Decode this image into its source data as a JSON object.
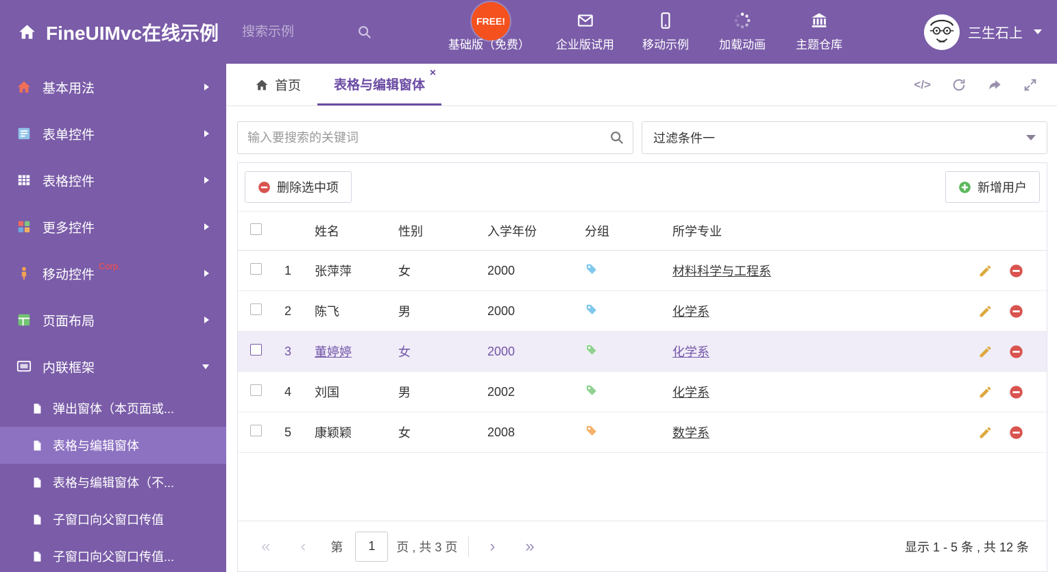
{
  "colors": {
    "accent": "#7a5ca8",
    "sidebar_active": "#8d72c2",
    "selected_row_bg": "#f0ecf8",
    "selected_row_text": "#7356a8",
    "danger": "#d9534f",
    "success": "#5cb85c",
    "pencil": "#dda83c",
    "free_badge_bg": "#f4511e"
  },
  "header": {
    "title": "FineUIMvc在线示例",
    "search_placeholder": "搜索示例",
    "free_badge": "FREE!",
    "nav": [
      {
        "label": "基础版（免费）",
        "icon": "download-icon"
      },
      {
        "label": "企业版试用",
        "icon": "envelope-icon"
      },
      {
        "label": "移动示例",
        "icon": "mobile-icon"
      },
      {
        "label": "加载动画",
        "icon": "spinner-icon"
      },
      {
        "label": "主题仓库",
        "icon": "bank-icon"
      }
    ],
    "user_name": "三生石上"
  },
  "sidebar": {
    "items": [
      {
        "label": "基本用法"
      },
      {
        "label": "表单控件"
      },
      {
        "label": "表格控件"
      },
      {
        "label": "更多控件"
      },
      {
        "label": "移动控件",
        "badge": "Corp."
      },
      {
        "label": "页面布局"
      },
      {
        "label": "内联框架"
      }
    ],
    "subitems": [
      {
        "label": "弹出窗体（本页面或..."
      },
      {
        "label": "表格与编辑窗体"
      },
      {
        "label": "表格与编辑窗体（不..."
      },
      {
        "label": "子窗口向父窗口传值"
      },
      {
        "label": "子窗口向父窗口传值..."
      }
    ]
  },
  "tabs": {
    "home_label": "首页",
    "active_label": "表格与编辑窗体",
    "close_symbol": "×",
    "code_tool": "</>"
  },
  "filter": {
    "search_placeholder": "输入要搜索的关键词",
    "selected_filter": "过滤条件一"
  },
  "toolbar": {
    "delete_label": "删除选中项",
    "add_label": "新增用户"
  },
  "table": {
    "headers": {
      "name": "姓名",
      "gender": "性别",
      "year": "入学年份",
      "group": "分组",
      "major": "所学专业"
    },
    "rows": [
      {
        "num": "1",
        "name": "张萍萍",
        "gender": "女",
        "year": "2000",
        "tag_color": "#7ec8ed",
        "major": "材料科学与工程系"
      },
      {
        "num": "2",
        "name": "陈飞",
        "gender": "男",
        "year": "2000",
        "tag_color": "#7ec8ed",
        "major": "化学系"
      },
      {
        "num": "3",
        "name": "董婷婷",
        "gender": "女",
        "year": "2000",
        "tag_color": "#90d190",
        "major": "化学系"
      },
      {
        "num": "4",
        "name": "刘国",
        "gender": "男",
        "year": "2002",
        "tag_color": "#90d190",
        "major": "化学系"
      },
      {
        "num": "5",
        "name": "康颖颖",
        "gender": "女",
        "year": "2008",
        "tag_color": "#f5b26b",
        "major": "数学系"
      }
    ]
  },
  "pager": {
    "first": "«",
    "prev": "‹",
    "next": "›",
    "last": "»",
    "prefix": "第",
    "current_page": "1",
    "suffix": "页 , 共 3 页",
    "summary": "显示 1 - 5 条 , 共 12 条"
  }
}
